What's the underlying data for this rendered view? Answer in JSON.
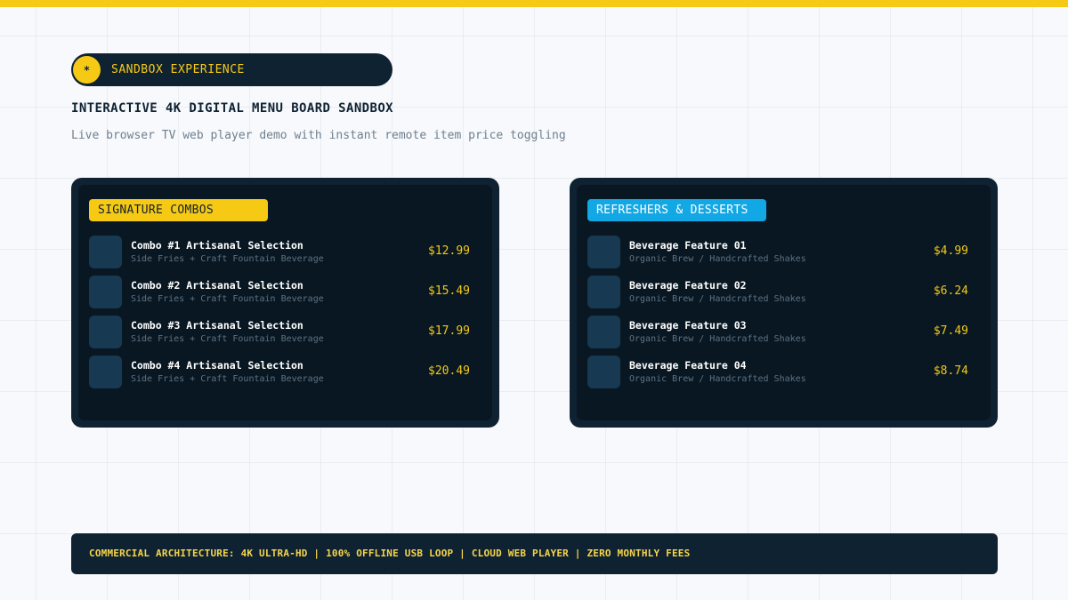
{
  "header": {
    "pill_icon": "*",
    "pill_label": "SANDBOX EXPERIENCE",
    "title": "INTERACTIVE 4K DIGITAL MENU BOARD SANDBOX",
    "subtitle": "Live browser TV web player demo with instant remote item price toggling"
  },
  "colors": {
    "accent_yellow": "#f6c915",
    "accent_blue": "#12a8e6",
    "panel_dark": "#0f2232",
    "panel_inner": "#081722"
  },
  "panels": [
    {
      "badge": "SIGNATURE COMBOS",
      "items": [
        {
          "name": "Combo #1 Artisanal Selection",
          "desc": "Side Fries + Craft Fountain Beverage",
          "price": "$12.99"
        },
        {
          "name": "Combo #2 Artisanal Selection",
          "desc": "Side Fries + Craft Fountain Beverage",
          "price": "$15.49"
        },
        {
          "name": "Combo #3 Artisanal Selection",
          "desc": "Side Fries + Craft Fountain Beverage",
          "price": "$17.99"
        },
        {
          "name": "Combo #4 Artisanal Selection",
          "desc": "Side Fries + Craft Fountain Beverage",
          "price": "$20.49"
        }
      ]
    },
    {
      "badge": "REFRESHERS & DESSERTS",
      "items": [
        {
          "name": "Beverage Feature 01",
          "desc": "Organic Brew / Handcrafted Shakes",
          "price": "$4.99"
        },
        {
          "name": "Beverage Feature 02",
          "desc": "Organic Brew / Handcrafted Shakes",
          "price": "$6.24"
        },
        {
          "name": "Beverage Feature 03",
          "desc": "Organic Brew / Handcrafted Shakes",
          "price": "$7.49"
        },
        {
          "name": "Beverage Feature 04",
          "desc": "Organic Brew / Handcrafted Shakes",
          "price": "$8.74"
        }
      ]
    }
  ],
  "footer": {
    "text": "COMMERCIAL ARCHITECTURE: 4K ULTRA-HD | 100% OFFLINE USB LOOP | CLOUD WEB PLAYER | ZERO MONTHLY FEES"
  }
}
